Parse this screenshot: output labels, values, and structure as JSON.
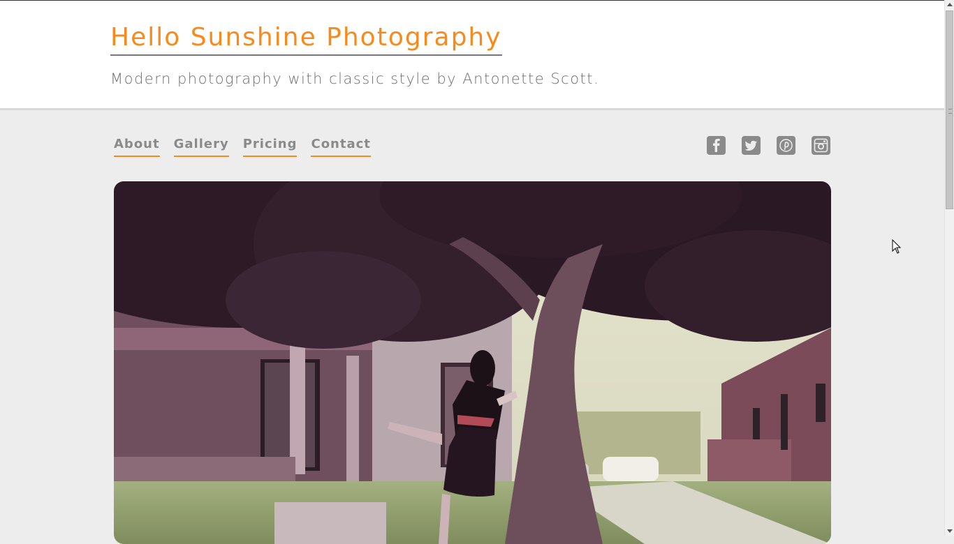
{
  "header": {
    "title": "Hello Sunshine Photography",
    "tagline": "Modern photography with classic style by Antonette Scott."
  },
  "nav": {
    "items": [
      {
        "label": "About"
      },
      {
        "label": "Gallery"
      },
      {
        "label": "Pricing"
      },
      {
        "label": "Contact"
      }
    ]
  },
  "social": {
    "icons": [
      "facebook-icon",
      "twitter-icon",
      "pinterest-icon",
      "instagram-icon"
    ]
  },
  "colors": {
    "accent": "#f78a1d",
    "nav_text": "#8a8a8a",
    "background": "#ededed"
  }
}
